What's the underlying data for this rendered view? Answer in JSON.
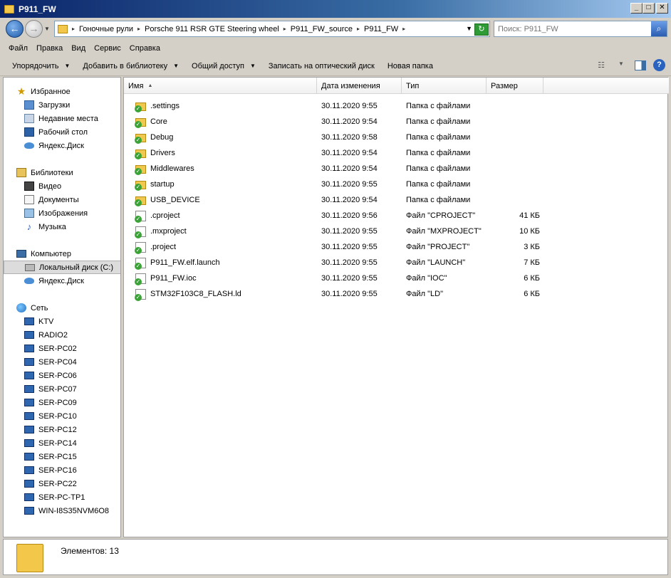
{
  "window": {
    "title": "P911_FW"
  },
  "address": {
    "crumbs": [
      "Гоночные рули",
      "Porsche 911 RSR GTE Steering wheel",
      "P911_FW_source",
      "P911_FW"
    ],
    "search_placeholder": "Поиск: P911_FW"
  },
  "menu": [
    "Файл",
    "Правка",
    "Вид",
    "Сервис",
    "Справка"
  ],
  "commands": [
    {
      "label": "Упорядочить",
      "dropdown": true
    },
    {
      "label": "Добавить в библиотеку",
      "dropdown": true
    },
    {
      "label": "Общий доступ",
      "dropdown": true
    },
    {
      "label": "Записать на оптический диск",
      "dropdown": false
    },
    {
      "label": "Новая папка",
      "dropdown": false
    }
  ],
  "nav": {
    "favorites": {
      "label": "Избранное",
      "items": [
        "Загрузки",
        "Недавние места",
        "Рабочий стол",
        "Яндекс.Диск"
      ]
    },
    "libraries": {
      "label": "Библиотеки",
      "items": [
        "Видео",
        "Документы",
        "Изображения",
        "Музыка"
      ]
    },
    "computer": {
      "label": "Компьютер",
      "items": [
        "Локальный диск (C:)",
        "Яндекс.Диск"
      ],
      "selected": "Локальный диск (C:)"
    },
    "network": {
      "label": "Сеть",
      "items": [
        "KTV",
        "RADIO2",
        "SER-PC02",
        "SER-PC04",
        "SER-PC06",
        "SER-PC07",
        "SER-PC09",
        "SER-PC10",
        "SER-PC12",
        "SER-PC14",
        "SER-PC15",
        "SER-PC16",
        "SER-PC22",
        "SER-PC-TP1",
        "WIN-I8S35NVM6O8"
      ]
    }
  },
  "columns": {
    "name": "Имя",
    "date": "Дата изменения",
    "type": "Тип",
    "size": "Размер"
  },
  "files": [
    {
      "name": ".settings",
      "date": "30.11.2020 9:55",
      "type": "Папка с файлами",
      "size": "",
      "kind": "folder"
    },
    {
      "name": "Core",
      "date": "30.11.2020 9:54",
      "type": "Папка с файлами",
      "size": "",
      "kind": "folder"
    },
    {
      "name": "Debug",
      "date": "30.11.2020 9:58",
      "type": "Папка с файлами",
      "size": "",
      "kind": "folder"
    },
    {
      "name": "Drivers",
      "date": "30.11.2020 9:54",
      "type": "Папка с файлами",
      "size": "",
      "kind": "folder"
    },
    {
      "name": "Middlewares",
      "date": "30.11.2020 9:54",
      "type": "Папка с файлами",
      "size": "",
      "kind": "folder"
    },
    {
      "name": "startup",
      "date": "30.11.2020 9:55",
      "type": "Папка с файлами",
      "size": "",
      "kind": "folder"
    },
    {
      "name": "USB_DEVICE",
      "date": "30.11.2020 9:54",
      "type": "Папка с файлами",
      "size": "",
      "kind": "folder"
    },
    {
      "name": ".cproject",
      "date": "30.11.2020 9:56",
      "type": "Файл \"CPROJECT\"",
      "size": "41 КБ",
      "kind": "file"
    },
    {
      "name": ".mxproject",
      "date": "30.11.2020 9:55",
      "type": "Файл \"MXPROJECT\"",
      "size": "10 КБ",
      "kind": "file"
    },
    {
      "name": ".project",
      "date": "30.11.2020 9:55",
      "type": "Файл \"PROJECT\"",
      "size": "3 КБ",
      "kind": "file"
    },
    {
      "name": "P911_FW.elf.launch",
      "date": "30.11.2020 9:55",
      "type": "Файл \"LAUNCH\"",
      "size": "7 КБ",
      "kind": "file"
    },
    {
      "name": "P911_FW.ioc",
      "date": "30.11.2020 9:55",
      "type": "Файл \"IOC\"",
      "size": "6 КБ",
      "kind": "file"
    },
    {
      "name": "STM32F103C8_FLASH.ld",
      "date": "30.11.2020 9:55",
      "type": "Файл \"LD\"",
      "size": "6 КБ",
      "kind": "file"
    }
  ],
  "status": {
    "count": "Элементов: 13"
  },
  "icons": {
    "sync_badge": "green-check-icon",
    "folder": "folder-icon",
    "file": "file-icon"
  }
}
